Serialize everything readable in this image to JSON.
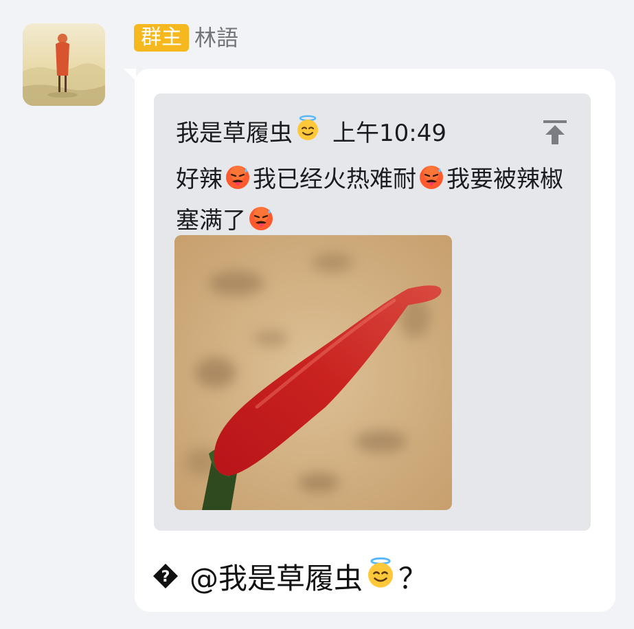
{
  "sender": {
    "role_badge": "群主",
    "name": "林語"
  },
  "quote": {
    "author": "我是草履虫",
    "author_emoji": "smiling-face-with-halo",
    "time": "上午10:49",
    "text_segments": [
      "好辣",
      "我已经火热难耐",
      "我要被辣椒塞满了"
    ],
    "text_emoji": "hot-face",
    "pin_icon": "pin-to-top-icon",
    "image_subject": "red chili pepper"
  },
  "reply": {
    "unknown_glyph": "replacement-character",
    "mention": "@我是草履虫",
    "mention_emoji": "smiling-face-with-halo",
    "suffix": "？"
  },
  "colors": {
    "background": "#f2f3f7",
    "bubble": "#ffffff",
    "quote_card": "#e6e7ea",
    "badge": "#f5b81f",
    "name": "#727579",
    "text": "#1b1c1f"
  }
}
